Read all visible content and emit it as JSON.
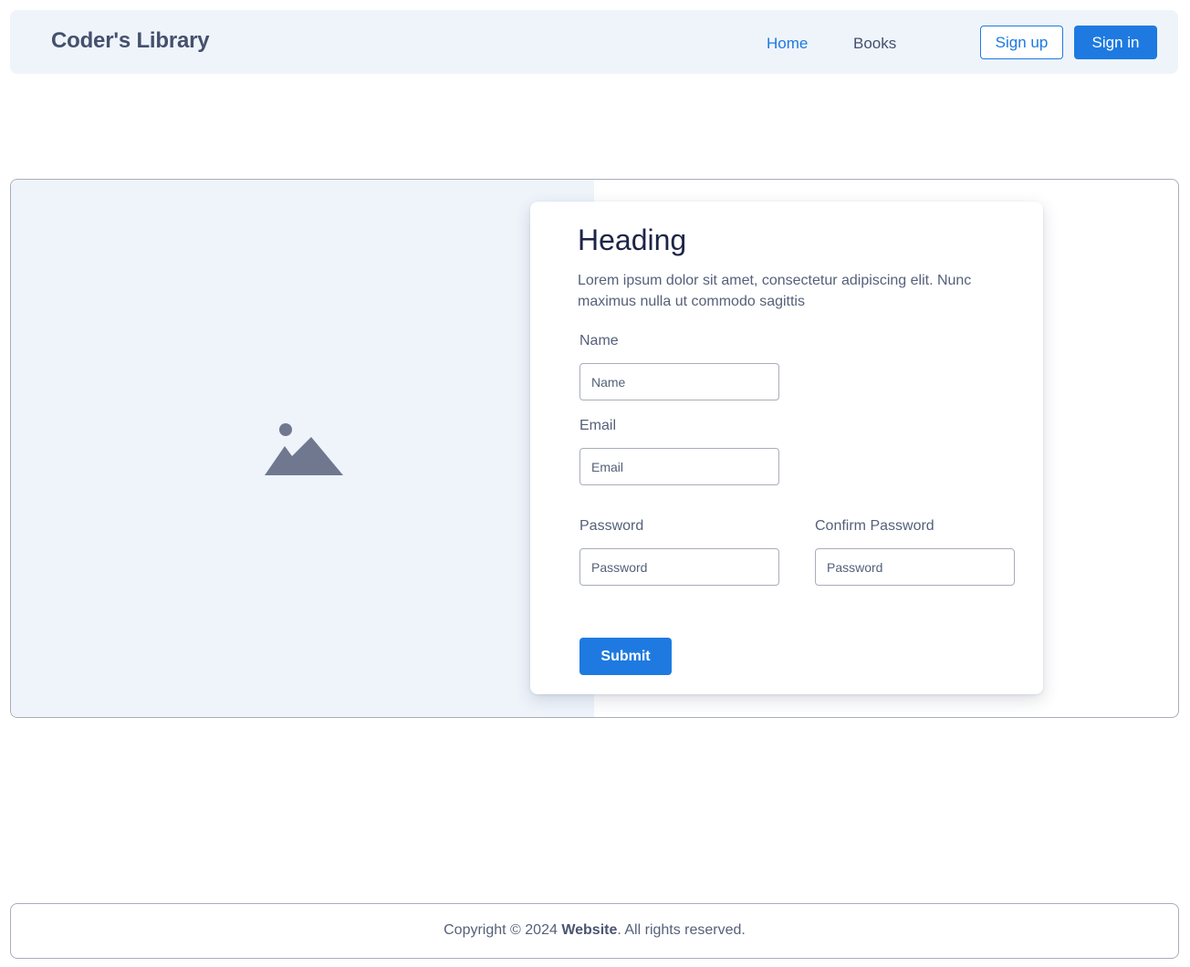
{
  "navbar": {
    "brand": "Coder's Library",
    "links": [
      {
        "label": "Home",
        "active": true
      },
      {
        "label": "Books",
        "active": false
      }
    ],
    "signup_label": "Sign up",
    "signin_label": "Sign in"
  },
  "hero": {
    "image_icon": "image-placeholder-icon",
    "card": {
      "heading": "Heading",
      "description": "Lorem ipsum dolor sit amet, consectetur adipiscing elit. Nunc maximus nulla ut commodo sagittis",
      "fields": {
        "name": {
          "label": "Name",
          "placeholder": "Name",
          "value": ""
        },
        "email": {
          "label": "Email",
          "placeholder": "Email",
          "value": ""
        },
        "password": {
          "label": "Password",
          "placeholder": "Password",
          "value": ""
        },
        "confirm_password": {
          "label": "Confirm Password",
          "placeholder": "Password",
          "value": ""
        }
      },
      "submit_label": "Submit"
    }
  },
  "footer": {
    "prefix": "Copyright © 2024 ",
    "site": "Website",
    "suffix": ". All rights reserved."
  },
  "colors": {
    "accent": "#1e7ae0",
    "panel": "#eff4fb",
    "text": "#44506d",
    "heading": "#1d2547"
  }
}
